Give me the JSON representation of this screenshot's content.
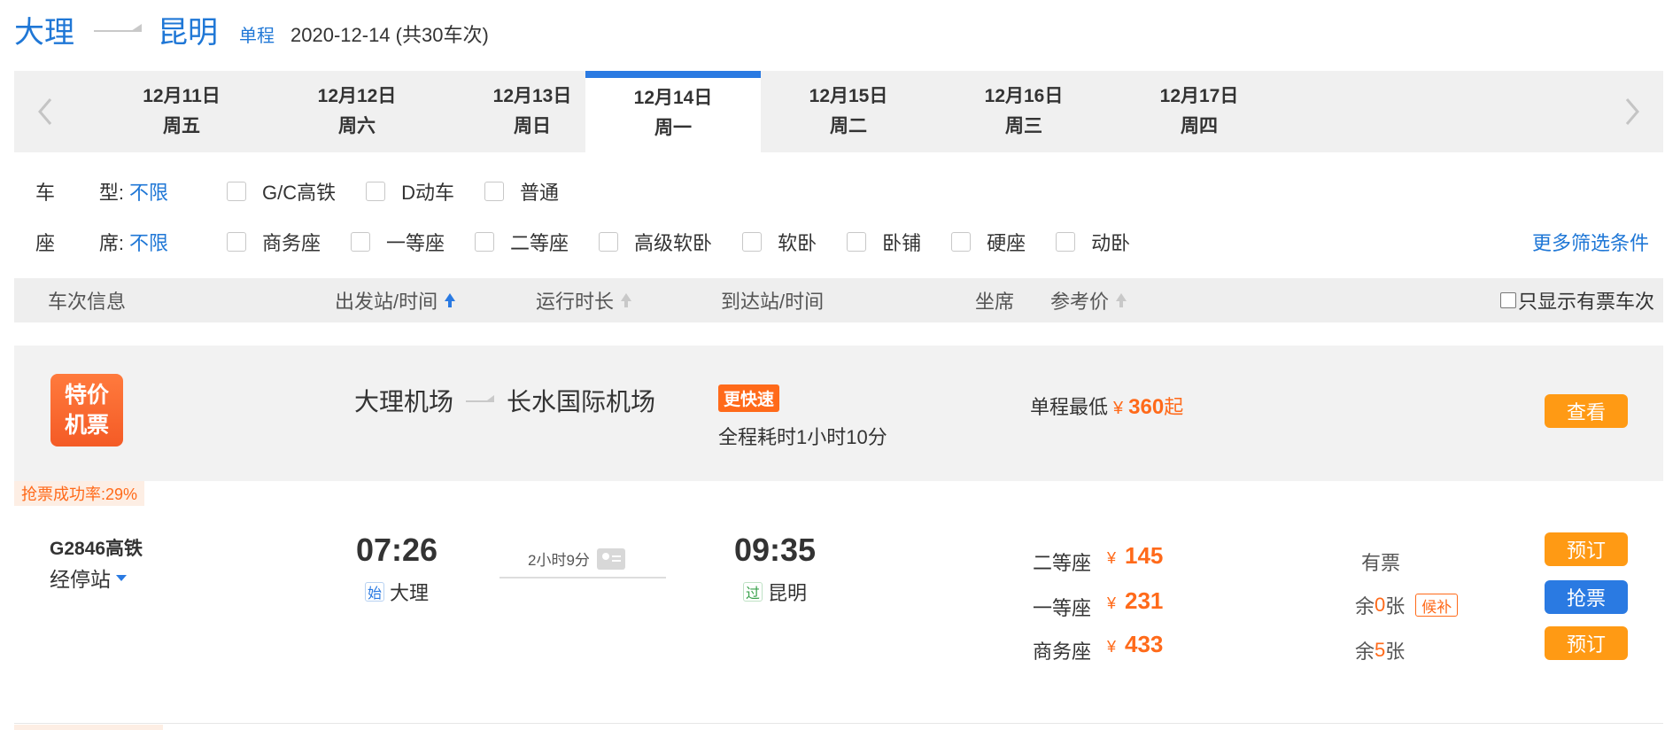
{
  "header": {
    "from": "大理",
    "to": "昆明",
    "trip_type": "单程",
    "date_info": "2020-12-14 (共30车次)"
  },
  "dates": [
    {
      "date": "12月11日",
      "weekday": "周五"
    },
    {
      "date": "12月12日",
      "weekday": "周六"
    },
    {
      "date": "12月13日",
      "weekday": "周日"
    },
    {
      "date": "12月14日",
      "weekday": "周一"
    },
    {
      "date": "12月15日",
      "weekday": "周二"
    },
    {
      "date": "12月16日",
      "weekday": "周三"
    },
    {
      "date": "12月17日",
      "weekday": "周四"
    }
  ],
  "active_date_index": 3,
  "filters": {
    "train_type": {
      "label_a": "车",
      "label_b": "型:",
      "all": "不限",
      "options": [
        "G/C高铁",
        "D动车",
        "普通"
      ]
    },
    "seat_type": {
      "label_a": "座",
      "label_b": "席:",
      "all": "不限",
      "options": [
        "商务座",
        "一等座",
        "二等座",
        "高级软卧",
        "软卧",
        "卧铺",
        "硬座",
        "动卧"
      ]
    },
    "more": "更多筛选条件"
  },
  "list_header": {
    "train_info": "车次信息",
    "depart": "出发站/时间",
    "duration": "运行时长",
    "arrive": "到达站/时间",
    "seat": "坐席",
    "price": "参考价",
    "only_available": "只显示有票车次"
  },
  "promo": {
    "badge_line1": "特价",
    "badge_line2": "机票",
    "from_airport": "大理机场",
    "to_airport": "长水国际机场",
    "fast_tag": "更快速",
    "duration": "全程耗时1小时10分",
    "price_prefix": "单程最低",
    "yen": "¥",
    "price": "360",
    "price_suffix": "起",
    "button": "查看"
  },
  "train": {
    "success_rate": "抢票成功率:29%",
    "number": "G2846高铁",
    "stops": "经停站",
    "depart_time": "07:26",
    "depart_tag": "始",
    "depart_station": "大理",
    "duration": "2小时9分",
    "arrive_time": "09:35",
    "arrive_tag": "过",
    "arrive_station": "昆明",
    "seats": [
      {
        "name": "二等座",
        "yen": "¥",
        "price": "145",
        "avail": "有票",
        "button": "预订",
        "style": "orange"
      },
      {
        "name": "一等座",
        "yen": "¥",
        "price": "231",
        "avail_prefix": "余",
        "avail_count": "0",
        "avail_suffix": "张",
        "houbu": "候补",
        "button": "抢票",
        "style": "blue"
      },
      {
        "name": "商务座",
        "yen": "¥",
        "price": "433",
        "avail_prefix": "余",
        "avail_count": "5",
        "avail_suffix": "张",
        "button": "预订",
        "style": "orange"
      }
    ]
  },
  "colors": {
    "accent_blue": "#2a7ae2",
    "accent_orange": "#ff9a14",
    "price_orange": "#ff6a1a"
  }
}
